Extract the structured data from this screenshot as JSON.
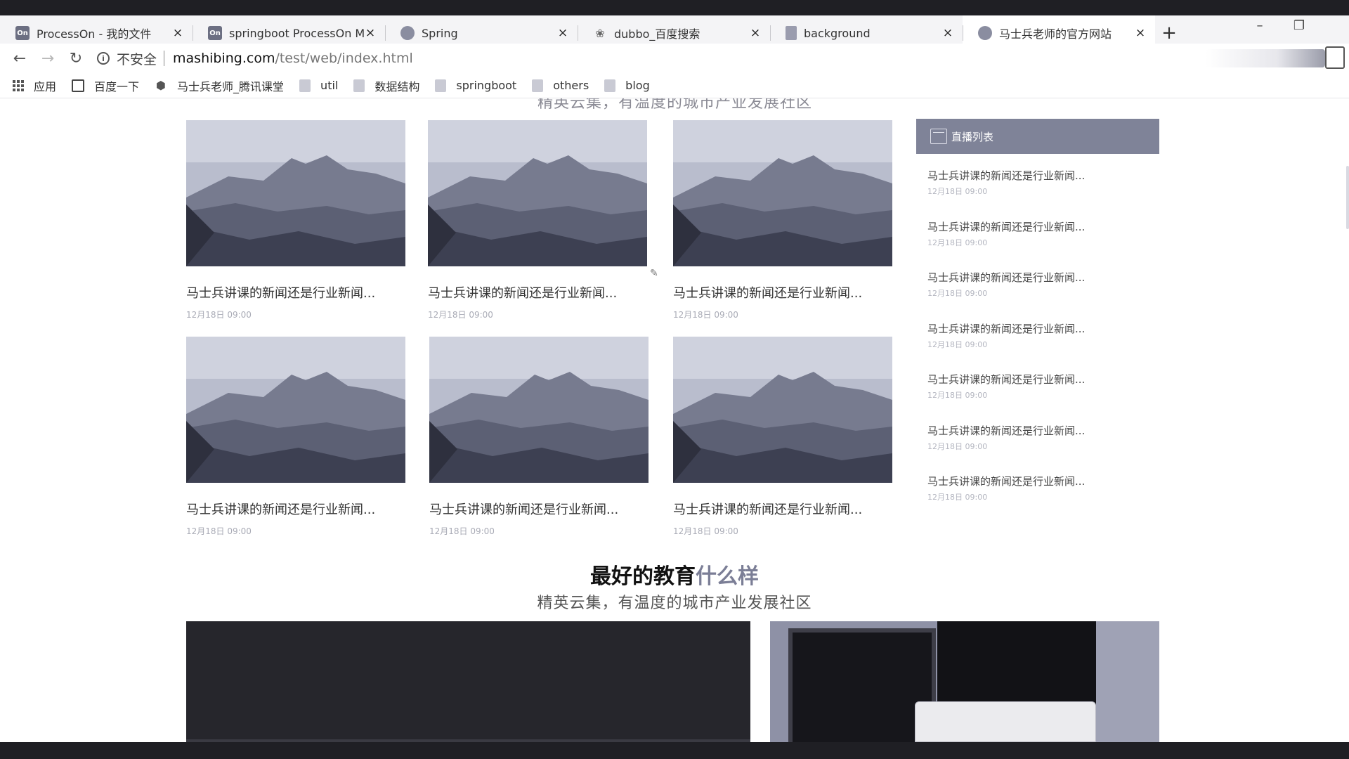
{
  "tabs": [
    {
      "icon": "processon-icon",
      "favicon_text": "On",
      "title": "ProcessOn - 我的文件",
      "close": "×"
    },
    {
      "icon": "processon-icon",
      "favicon_text": "On",
      "title": "springboot ProcessOn Mi",
      "close": "×"
    },
    {
      "icon": "spring-icon",
      "favicon_text": "",
      "title": "Spring",
      "close": "×"
    },
    {
      "icon": "baidu-paw-icon",
      "favicon_text": "❀",
      "title": "dubbo_百度搜索",
      "close": "×"
    },
    {
      "icon": "document-icon",
      "favicon_text": "",
      "title": "background",
      "close": "×"
    },
    {
      "icon": "globe-icon",
      "favicon_text": "",
      "title": "马士兵老师的官方网站",
      "close": "×"
    }
  ],
  "new_tab": "+",
  "window_controls": {
    "minimize": "–",
    "maximize": "❐",
    "close": "✕"
  },
  "nav": {
    "back": "←",
    "forward": "→",
    "reload": "↻"
  },
  "address": {
    "info": "i",
    "security_label": "不安全",
    "host": "mashibing.com",
    "path": "/test/web/index.html"
  },
  "bookmarks": [
    {
      "icon": "apps-icon",
      "label": "应用"
    },
    {
      "icon": "baidu-icon",
      "label": "百度一下"
    },
    {
      "icon": "shield-icon",
      "label": "马士兵老师_腾讯课堂"
    },
    {
      "icon": "folder-icon",
      "label": "util"
    },
    {
      "icon": "folder-icon",
      "label": "数据结构"
    },
    {
      "icon": "folder-icon",
      "label": "springboot"
    },
    {
      "icon": "folder-icon",
      "label": "others"
    },
    {
      "icon": "folder-icon",
      "label": "blog"
    }
  ],
  "cut_heading": "精英云集，有温度的城市产业发展社区",
  "news_cards": [
    {
      "title": "马士兵讲课的新闻还是行业新闻...",
      "date": "12月18日 09:00"
    },
    {
      "title": "马士兵讲课的新闻还是行业新闻...",
      "date": "12月18日 09:00"
    },
    {
      "title": "马士兵讲课的新闻还是行业新闻...",
      "date": "12月18日 09:00"
    },
    {
      "title": "马士兵讲课的新闻还是行业新闻...",
      "date": "12月18日 09:00"
    },
    {
      "title": "马士兵讲课的新闻还是行业新闻...",
      "date": "12月18日 09:00"
    },
    {
      "title": "马士兵讲课的新闻还是行业新闻...",
      "date": "12月18日 09:00"
    }
  ],
  "live_list": {
    "header": "直播列表",
    "items": [
      {
        "title": "马士兵讲课的新闻还是行业新闻...",
        "date": "12月18日 09:00"
      },
      {
        "title": "马士兵讲课的新闻还是行业新闻...",
        "date": "12月18日 09:00"
      },
      {
        "title": "马士兵讲课的新闻还是行业新闻...",
        "date": "12月18日 09:00"
      },
      {
        "title": "马士兵讲课的新闻还是行业新闻...",
        "date": "12月18日 09:00"
      },
      {
        "title": "马士兵讲课的新闻还是行业新闻...",
        "date": "12月18日 09:00"
      },
      {
        "title": "马士兵讲课的新闻还是行业新闻...",
        "date": "12月18日 09:00"
      },
      {
        "title": "马士兵讲课的新闻还是行业新闻...",
        "date": "12月18日 09:00"
      }
    ]
  },
  "section": {
    "title_main": "最好的教育",
    "title_accent": "什么样",
    "subtitle": "精英云集，有温度的城市产业发展社区"
  },
  "colors": {
    "accent": "#7b7e96",
    "sidebar_header": "#7f8398",
    "page_bg": "#ffffff",
    "chrome_bg": "#f4f4f6"
  }
}
